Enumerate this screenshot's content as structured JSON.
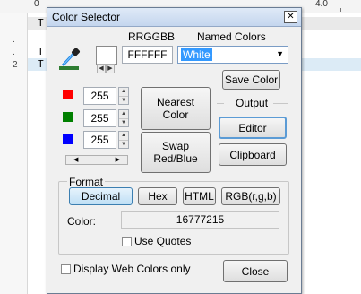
{
  "editor": {
    "ruler": {
      "label_0": "0",
      "label_4": "4.0"
    },
    "lines": [
      {
        "num": "",
        "text": "T"
      },
      {
        "num": ".",
        "text": ""
      },
      {
        "num": ".",
        "text": "T"
      },
      {
        "num": "2",
        "text": "T"
      }
    ]
  },
  "dialog": {
    "title": "Color Selector",
    "close_glyph": "✕",
    "rrggbb_label": "RRGGBB",
    "named_colors_label": "Named Colors",
    "hex_value": "FFFFFF",
    "named_color_value": "White",
    "save_color": "Save Color",
    "red_value": "255",
    "green_value": "255",
    "blue_value": "255",
    "nearest_color": "Nearest\nColor",
    "swap": "Swap\nRed/Blue",
    "output_label": "Output",
    "editor_button": "Editor",
    "clipboard_button": "Clipboard",
    "format_label": "Format",
    "formats": [
      "Decimal",
      "Hex",
      "HTML",
      "RGB(r,g,b)"
    ],
    "selected_format": "Decimal",
    "color_label": "Color:",
    "color_value": "16777215",
    "use_quotes": "Use Quotes",
    "display_web_colors": "Display Web Colors only",
    "close_button": "Close"
  },
  "colors": {
    "red": "#ff0000",
    "green": "#008000",
    "blue": "#0000ff",
    "selection": "#3399ff",
    "current_color": "#ffffff"
  }
}
